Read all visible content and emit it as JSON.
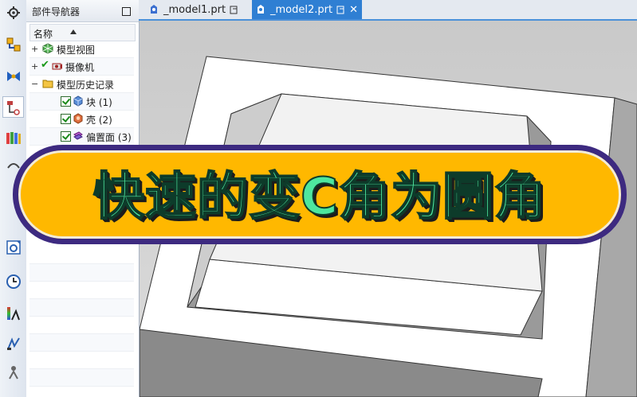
{
  "resource_bar": {
    "icons": [
      "settings-icon",
      "assembly-navigator-icon",
      "constraint-navigator-icon",
      "part-navigator-icon",
      "reuse-library-icon",
      "hd3d-tools-icon",
      "web-browser-icon",
      "history-icon",
      "visual-analysis-icon",
      "process-studio-icon",
      "roles-icon"
    ]
  },
  "navigator": {
    "title": "部件导航器",
    "column_header": "名称",
    "items": [
      {
        "expander": "+",
        "label": "模型视图",
        "icon": "model-views-icon",
        "checked": false
      },
      {
        "expander": "+",
        "label": "摄像机",
        "icon": "camera-icon",
        "checked": true
      },
      {
        "expander": "−",
        "label": "模型历史记录",
        "icon": "folder-icon",
        "checked": false
      },
      {
        "expander": "",
        "label": "块 (1)",
        "icon": "block-feature-icon",
        "checked": true
      },
      {
        "expander": "",
        "label": "壳 (2)",
        "icon": "shell-feature-icon",
        "checked": true
      },
      {
        "expander": "",
        "label": "偏置面 (3)",
        "icon": "offset-face-icon",
        "checked": true
      }
    ]
  },
  "tabs": [
    {
      "label": "_model1.prt",
      "active": false
    },
    {
      "label": "_model2.prt",
      "active": true
    }
  ],
  "banner": {
    "text": "快速的变C角为圆角",
    "fill_color": "#ffb800",
    "border_color": "#3d2a80",
    "text_color": "#4ee69e"
  },
  "colors": {
    "accent": "#2f7fd3",
    "viewport_bg": "#d2d2d2"
  }
}
